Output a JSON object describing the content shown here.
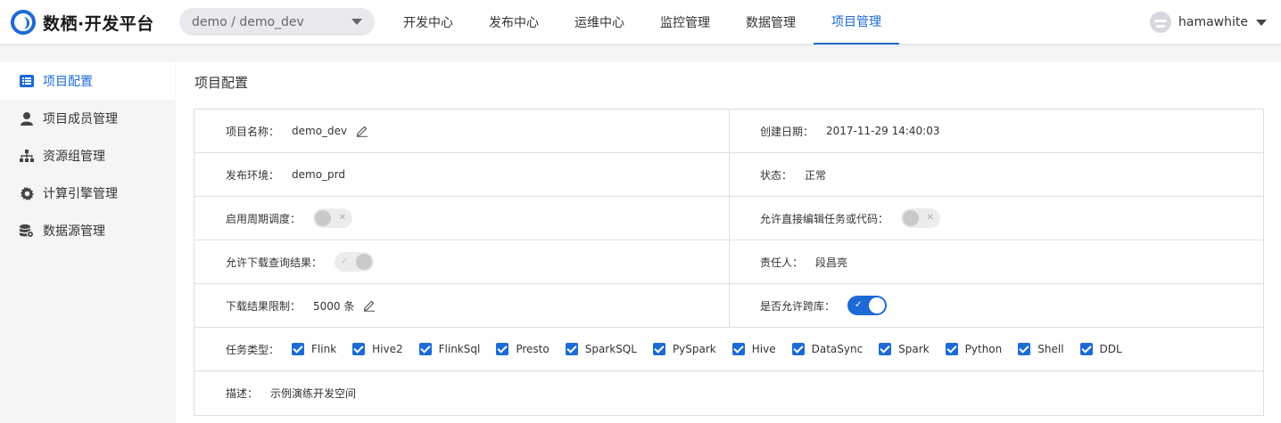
{
  "header": {
    "logo_text": "数栖·开发平台",
    "project_select": "demo / demo_dev",
    "nav": [
      "开发中心",
      "发布中心",
      "运维中心",
      "监控管理",
      "数据管理",
      "项目管理"
    ],
    "active_nav": "项目管理",
    "user": "hamawhite"
  },
  "sidebar": {
    "items": [
      {
        "label": "项目配置",
        "icon": "list-icon",
        "active": true
      },
      {
        "label": "项目成员管理",
        "icon": "user-icon",
        "active": false
      },
      {
        "label": "资源组管理",
        "icon": "org-tree-icon",
        "active": false
      },
      {
        "label": "计算引擎管理",
        "icon": "gear-icon",
        "active": false
      },
      {
        "label": "数据源管理",
        "icon": "database-icon",
        "active": false
      }
    ]
  },
  "main": {
    "title": "项目配置",
    "project_name_label": "项目名称：",
    "project_name": "demo_dev",
    "created_label": "创建日期：",
    "created": "2017-11-29 14:40:03",
    "env_label": "发布环境：",
    "env": "demo_prd",
    "status_label": "状态：",
    "status": "正常",
    "schedule_label": "启用周期调度：",
    "schedule_enabled": false,
    "direct_edit_label": "允许直接编辑任务或代码：",
    "direct_edit_enabled": false,
    "download_label": "允许下载查询结果：",
    "download_enabled": true,
    "owner_label": "责任人：",
    "owner": "段昌亮",
    "limit_label": "下载结果限制：",
    "limit": "5000 条",
    "cross_db_label": "是否允许跨库：",
    "cross_db_enabled": true,
    "task_types_label": "任务类型：",
    "task_types": [
      "Flink",
      "Hive2",
      "FlinkSql",
      "Presto",
      "SparkSQL",
      "PySpark",
      "Hive",
      "DataSync",
      "Spark",
      "Python",
      "Shell",
      "DDL"
    ],
    "desc_label": "描述：",
    "desc": "示例演练开发空间"
  },
  "colors": {
    "accent": "#1d6ad6",
    "switch_off": "#ececec"
  }
}
